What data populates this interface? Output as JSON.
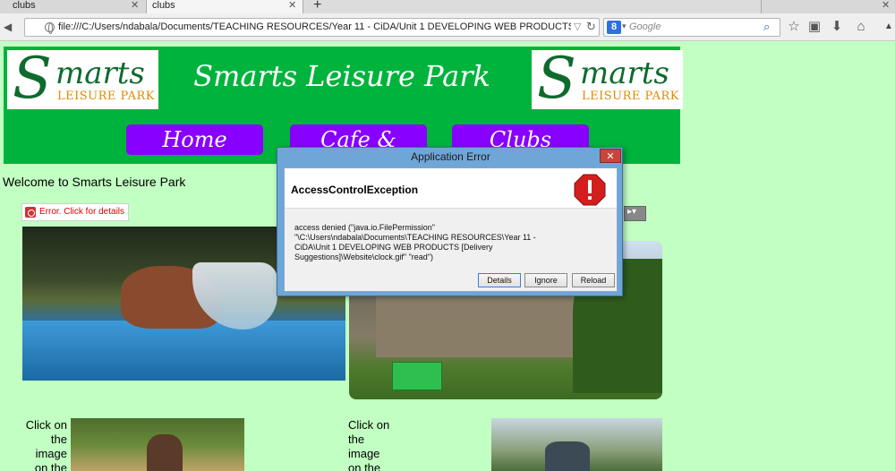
{
  "browser": {
    "tabs": [
      {
        "title": "clubs"
      },
      {
        "title": "clubs"
      },
      {
        "title": ""
      }
    ],
    "new_tab_symbol": "+",
    "url": "file:///C:/Users/ndabala/Documents/TEACHING RESOURCES/Year 11 - CiDA/Unit 1 DEVELOPING WEB PRODUCTS [Delivery Suggestions]/Website/c",
    "search_placeholder": "Google",
    "icons": [
      "back-icon",
      "globe-icon",
      "reload-icon",
      "google-icon",
      "search-icon",
      "bookmark-star-icon",
      "reading-list-icon",
      "download-icon",
      "home-icon",
      "scroll-up-icon"
    ]
  },
  "site": {
    "title": "Smarts Leisure Park",
    "logo": {
      "word": "marts",
      "initial": "S",
      "subtitle": "LEISURE PARK"
    },
    "menu": [
      {
        "label": "Home"
      },
      {
        "label": "Cafe & Shop"
      },
      {
        "label": "Clubs"
      }
    ],
    "welcome": "Welcome to Smarts Leisure Park",
    "applet_error": "Error. Click for details",
    "captions": {
      "left": "Click on the image on the",
      "right": "Click on the image on the"
    },
    "colors": {
      "page_bg": "#c2ffc2",
      "header": "#00b33c",
      "menu": "#8800ff",
      "logo_green": "#0e6b2e",
      "logo_orange": "#e08a00"
    }
  },
  "dialog": {
    "title": "Application Error",
    "heading": "AccessControlException",
    "message": "access denied (\"java.io.FilePermission\" \"\\C:\\Users\\ndabala\\Documents\\TEACHING RESOURCES\\Year 11 - CiDA\\Unit 1 DEVELOPING WEB PRODUCTS [Delivery Suggestions]\\Website\\clock.gif\" \"read\")",
    "buttons": {
      "details": "Details",
      "ignore": "Ignore",
      "reload": "Reload"
    },
    "close_symbol": "✕"
  }
}
